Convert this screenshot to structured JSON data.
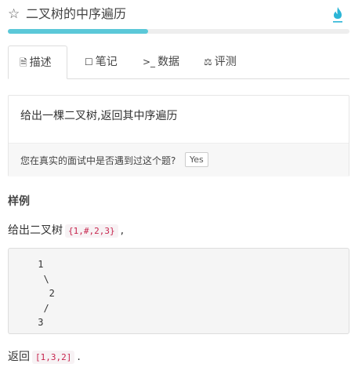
{
  "header": {
    "star_icon": "☆",
    "title": "二叉树的中序遍历",
    "fire_icon": "fire-icon",
    "progress_fraction": 0.41
  },
  "tabs": [
    {
      "label": "描述",
      "icon": "document-icon",
      "glyph": "🗎"
    },
    {
      "label": "笔记",
      "icon": "note-icon",
      "glyph": "☐"
    },
    {
      "label": "数据",
      "icon": "terminal-icon",
      "glyph": ">_"
    },
    {
      "label": "评测",
      "icon": "scale-icon",
      "glyph": "⚖"
    }
  ],
  "description": {
    "text": "给出一棵二叉树,返回其中序遍历",
    "question": "您在真实的面试中是否遇到过这个题?",
    "yes_label": "Yes"
  },
  "example": {
    "heading": "样例",
    "prefix": "给出二叉树",
    "input_code": "{1,#,2,3}",
    "suffix": ",",
    "tree": " 1\n  \\\n   2\n  /\n 3",
    "return_prefix": "返回",
    "return_code": "[1,3,2]",
    "return_suffix": "."
  },
  "colors": {
    "accent": "#5bc8d8",
    "fire": "#2bb5d6",
    "code_text": "#c7254e"
  }
}
